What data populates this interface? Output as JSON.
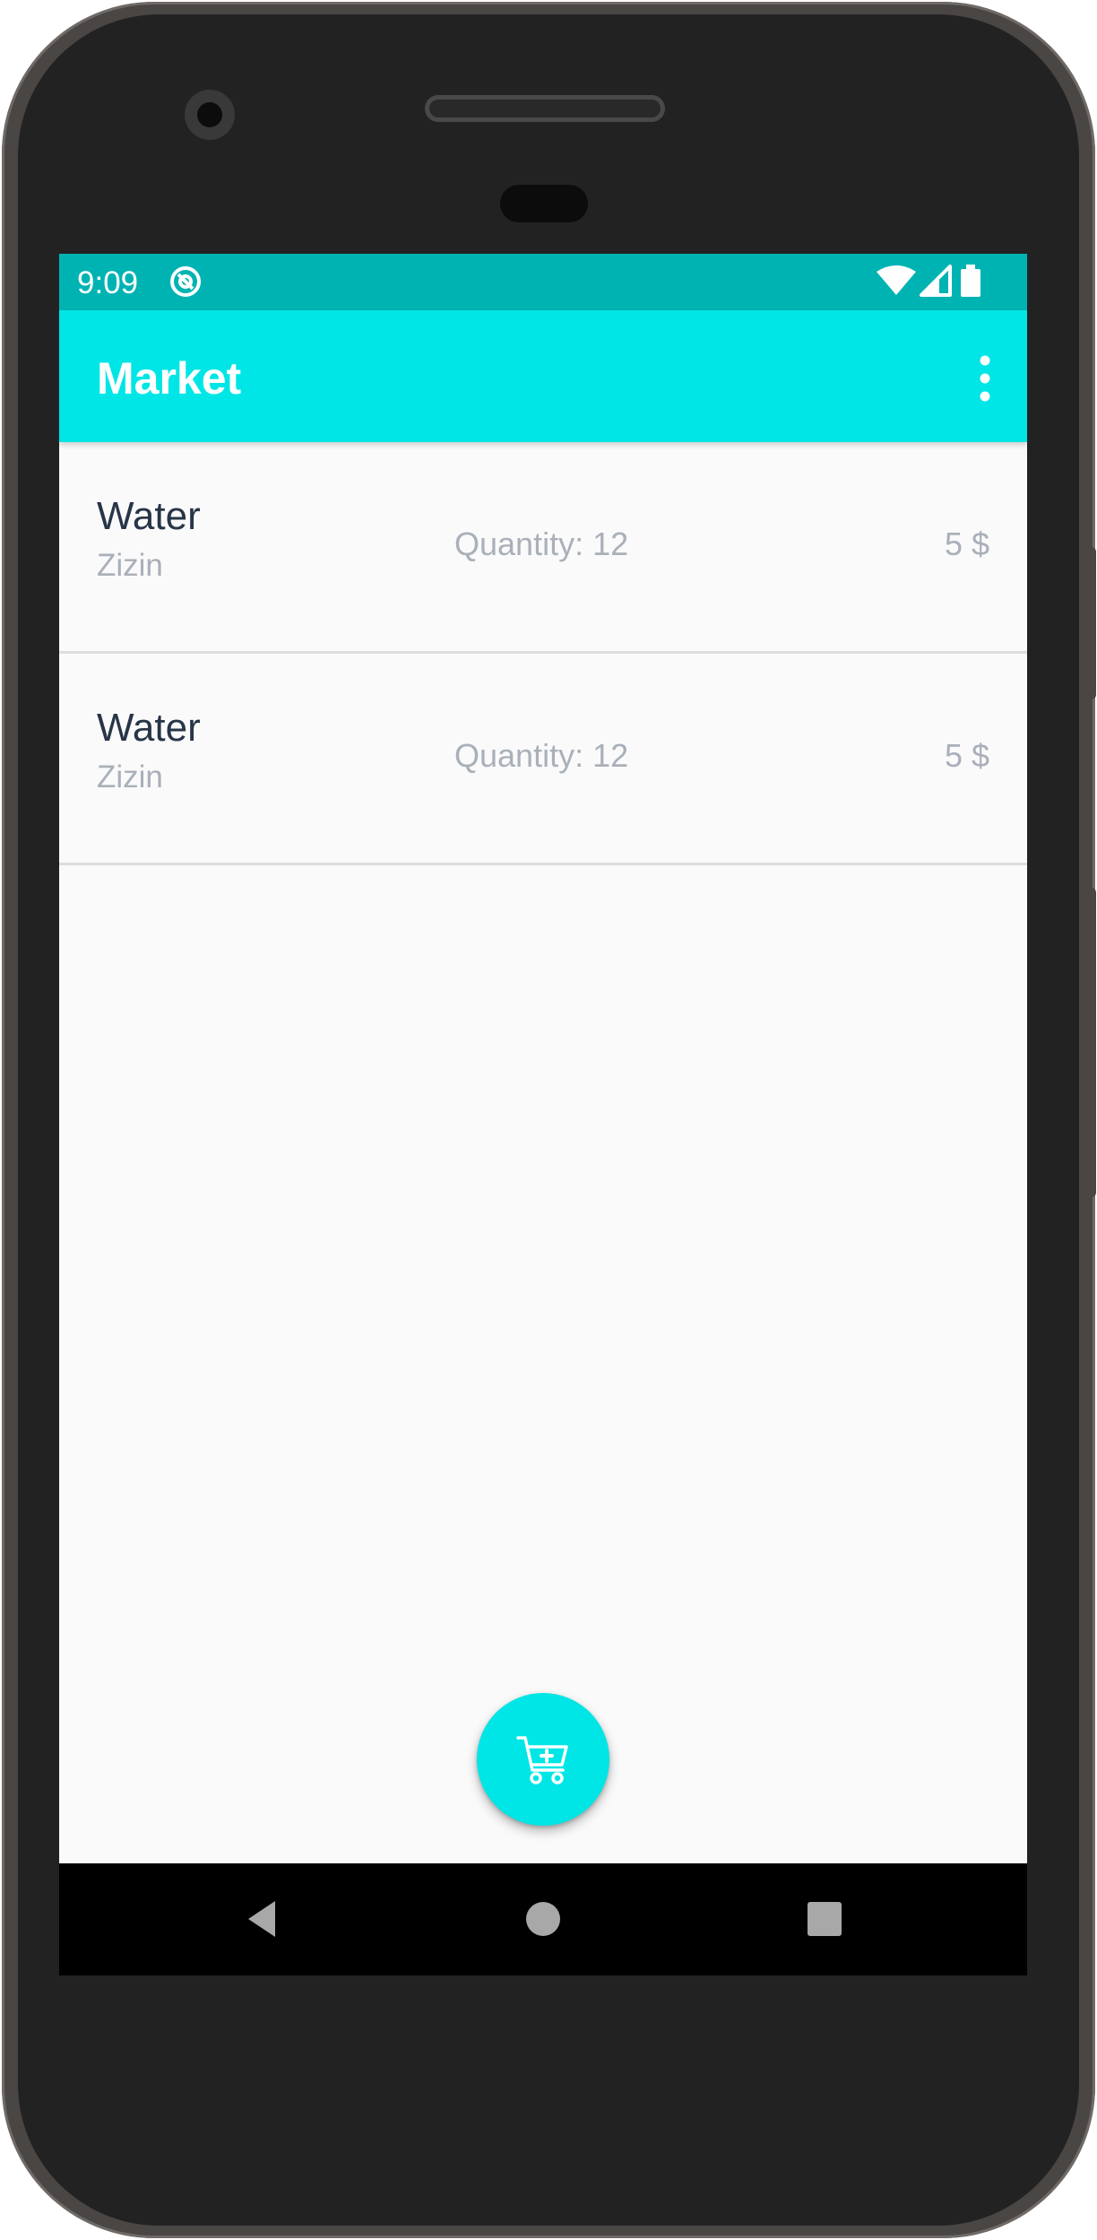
{
  "status_bar": {
    "time": "9:09",
    "app_icon": "at-sign-icon",
    "icons": [
      "wifi-icon",
      "cell-signal-icon",
      "battery-icon"
    ]
  },
  "app_bar": {
    "title": "Market",
    "overflow_icon": "more-vertical-icon"
  },
  "items": [
    {
      "name": "Water",
      "brand": "Zizin",
      "quantity": "Quantity: 12",
      "price": "5 $"
    },
    {
      "name": "Water",
      "brand": "Zizin",
      "quantity": "Quantity: 12",
      "price": "5 $"
    }
  ],
  "fab": {
    "icon": "add-to-cart-icon"
  },
  "nav_bar": {
    "icons": [
      "back-triangle-icon",
      "home-circle-icon",
      "recents-square-icon"
    ]
  },
  "colors": {
    "status_bar": "#00b3b3",
    "app_bar": "#00e5e5",
    "accent": "#00e5e5",
    "item_title": "#283548",
    "secondary_text": "#a9b0b9",
    "background": "#fafafa"
  }
}
